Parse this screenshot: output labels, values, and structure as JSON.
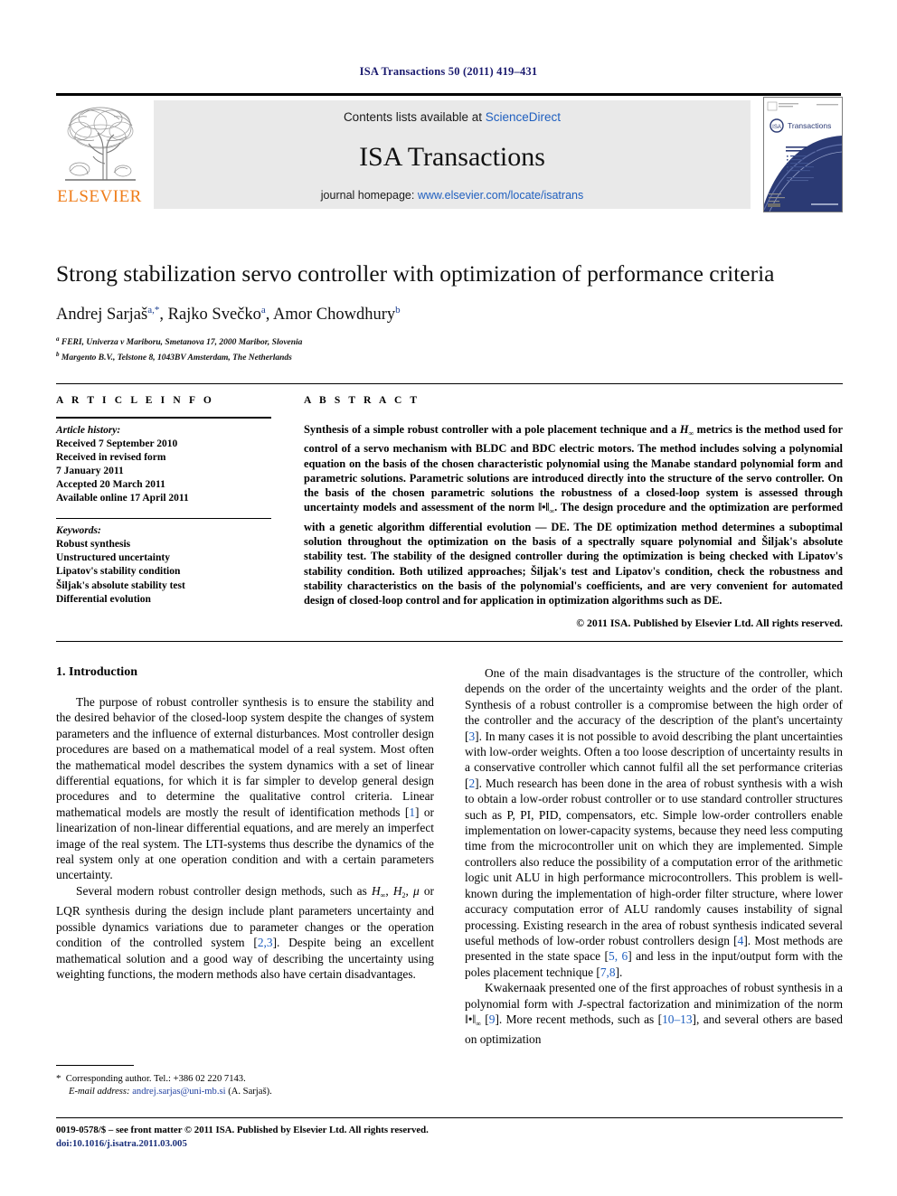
{
  "running_head": "ISA Transactions 50 (2011) 419–431",
  "banner": {
    "publisher_wordmark": "ELSEVIER",
    "contents_prefix": "Contents lists available at ",
    "contents_link": "ScienceDirect",
    "journal_name": "ISA Transactions",
    "homepage_prefix": "journal homepage: ",
    "homepage_url": "www.elsevier.com/locate/isatrans",
    "cover_title": "Transactions",
    "cover_subtitle": "The Science and Engineering of Measurement and Automation",
    "cover_bullets": [
      "Measurement",
      "Control",
      "Automation",
      "Wireless Instrumentation",
      "System Management"
    ],
    "cover_footer": "For research and development in automation and industry"
  },
  "article": {
    "title": "Strong stabilization servo controller with optimization of performance criteria",
    "authors_html": "Andrej Sarjaš<sup>a,*</sup>, Rajko Svečko<sup>a</sup>, Amor Chowdhury<sup>b</sup>",
    "affiliation_a": "FERI, Univerza v Mariboru, Smetanova 17, 2000 Maribor, Slovenia",
    "affiliation_b": "Margento B.V., Telstone 8, 1043BV Amsterdam, The Netherlands"
  },
  "info": {
    "heading": "A R T I C L E    I N F O",
    "history_label": "Article history:",
    "history": [
      "Received 7 September 2010",
      "Received in revised form",
      "7 January 2011",
      "Accepted 20 March 2011",
      "Available online 17 April 2011"
    ],
    "keywords_label": "Keywords:",
    "keywords": [
      "Robust synthesis",
      "Unstructured uncertainty",
      "Lipatov's stability condition",
      "Šiljak's absolute stability test",
      "Differential evolution"
    ]
  },
  "abstract": {
    "heading": "A B S T R A C T",
    "text_html": "Synthesis of a simple robust controller with a pole placement technique and a <span class=\"norm\"><i>H</i><sub class=\"inf\">∞</sub></span> metrics is the method used for control of a servo mechanism with BLDC and BDC electric motors. The method includes solving a polynomial equation on the basis of the chosen characteristic polynomial using the Manabe standard polynomial form and parametric solutions. Parametric solutions are introduced directly into the structure of the servo controller. On the basis of the chosen parametric solutions the robustness of a closed-loop system is assessed through uncertainty models and assessment of the norm ‖•‖<sub class=\"inf\">∞</sub>. The design procedure and the optimization are performed with a genetic algorithm differential evolution — DE. The DE optimization method determines a suboptimal solution throughout the optimization on the basis of a spectrally square polynomial and Šiljak's absolute stability test. The stability of the designed controller during the optimization is being checked with Lipatov's stability condition. Both utilized approaches; Šiljak's test and Lipatov's condition, check the robustness and stability characteristics on the basis of the polynomial's coefficients, and are very convenient for automated design of closed-loop control and for application in optimization algorithms such as DE.",
    "copyright": "© 2011 ISA. Published by Elsevier Ltd. All rights reserved."
  },
  "body": {
    "section_heading": "1. Introduction",
    "left_paragraphs_html": [
      "The purpose of robust controller synthesis is to ensure the stability and the desired behavior of the closed-loop system despite the changes of system parameters and the influence of external disturbances. Most controller design procedures are based on a mathematical model of a real system. Most often the mathematical model describes the system dynamics with a set of linear differential equations, for which it is far simpler to develop general design procedures and to determine the qualitative control criteria. Linear mathematical models are mostly the result of identification methods [<span class=\"ref\">1</span>] or linearization of non-linear differential equations, and are merely an imperfect image of the real system. The LTI-systems thus describe the dynamics of the real system only at one operation condition and with a certain parameters uncertainty.",
      "Several modern robust controller design methods, such as <i>H</i><sub class=\"inf\">∞</sub>, <i>H</i><sub class=\"inf\">2</sub>, <i>μ</i> or LQR synthesis during the design include plant parameters uncertainty and possible dynamics variations due to parameter changes or the operation condition of the controlled system [<span class=\"ref\">2,3</span>]. Despite being an excellent mathematical solution and a good way of describing the uncertainty using weighting functions, the modern methods also have certain disadvantages."
    ],
    "right_paragraphs_html": [
      "One of the main disadvantages is the structure of the controller, which depends on the order of the uncertainty weights and the order of the plant. Synthesis of a robust controller is a compromise between the high order of the controller and the accuracy of the description of the plant's uncertainty [<span class=\"ref\">3</span>]. In many cases it is not possible to avoid describing the plant uncertainties with low-order weights. Often a too loose description of uncertainty results in a conservative controller which cannot fulfil all the set  performance criterias [<span class=\"ref\">2</span>]. Much research has been done in the area of robust synthesis with a wish to obtain a low-order robust controller or to use standard controller structures such as P, PI, PID, compensators, etc. Simple low-order controllers enable implementation on lower-capacity systems, because they need less computing time from the microcontroller unit on which they are implemented. Simple controllers also reduce the possibility of a computation error of the arithmetic logic unit ALU in high performance microcontrollers. This problem is well-known during the implementation of high-order filter structure, where lower accuracy computation error of ALU randomly causes instability of signal processing. Existing research in the area of robust synthesis indicated several useful methods of low-order robust controllers design [<span class=\"ref\">4</span>]. Most methods are presented in the state space [<span class=\"ref\">5, 6</span>] and less in the input/output form with the poles placement technique [<span class=\"ref\">7,8</span>].",
      "Kwakernaak presented one of the first approaches of robust synthesis in a polynomial form with <i>J</i>-spectral factorization and minimization of the norm ‖•‖<sub class=\"inf\">∞</sub> [<span class=\"ref\">9</span>]. More recent methods, such as [<span class=\"ref\">10–13</span>], and several others are based on optimization"
    ]
  },
  "footnote": {
    "corresponding_html": "<span class=\"star\">*</span>&nbsp; Corresponding author. Tel.: +386 02 220 7143.",
    "email_label": "E-mail address:",
    "email": "andrej.sarjas@uni-mb.si",
    "email_suffix": "(A. Sarjaš)."
  },
  "footer": {
    "issn_line": "0019-0578/$ – see front matter © 2011 ISA. Published by Elsevier Ltd. All rights reserved.",
    "doi_line": "doi:10.1016/j.isatra.2011.03.005"
  },
  "colors": {
    "link_blue": "#1f5fbf",
    "header_navy": "#1a1a6e",
    "elsevier_orange": "#ef7d1a",
    "panel_gray": "#e9e9e9",
    "cover_navy": "#2b3a74"
  }
}
